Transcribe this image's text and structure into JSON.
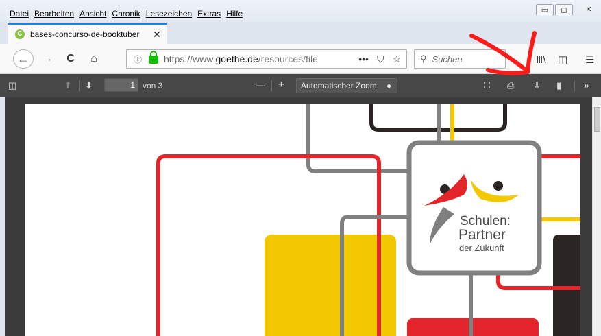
{
  "menu": [
    "Datei",
    "Bearbeiten",
    "Ansicht",
    "Chronik",
    "Lesezeichen",
    "Extras",
    "Hilfe"
  ],
  "window_controls": {
    "minimize": "▭",
    "maximize": "◻",
    "close": "✕"
  },
  "tab": {
    "title": "bases-concurso-de-booktuber",
    "close": "✕",
    "favicon": "C"
  },
  "nav": {
    "url_prefix": "https://www.",
    "url_domain": "goethe.de",
    "url_rest": "/resources/file",
    "search_placeholder": "Suchen",
    "page_actions": "•••"
  },
  "pdf_toolbar": {
    "page_number": "1",
    "page_count": "von 3",
    "zoom_minus": "—",
    "zoom_plus": "+",
    "zoom_value": "Automatischer Zoom",
    "zoom_arrows": "⌃⌄"
  },
  "document": {
    "logo_line1": "Schulen:",
    "logo_line2": "Partner",
    "logo_line3": "der Zukunft"
  },
  "colors": {
    "accent": "#0a84ff",
    "toolbar_dark": "#474747",
    "logo_red": "#e3262b",
    "logo_yellow": "#f2c800",
    "logo_gray": "#808080",
    "logo_black": "#2a2522"
  },
  "icons": [
    "back-icon",
    "forward-icon",
    "reload-icon",
    "home-icon",
    "info-icon",
    "lock-icon",
    "pocket-icon",
    "bookmark-star-icon",
    "search-icon",
    "library-icon",
    "sidebar-icon",
    "menu-icon",
    "sidebar-toggle-icon",
    "previous-page-icon",
    "next-page-icon",
    "presentation-icon",
    "print-icon",
    "download-icon",
    "bookmark-icon",
    "tools-icon"
  ]
}
